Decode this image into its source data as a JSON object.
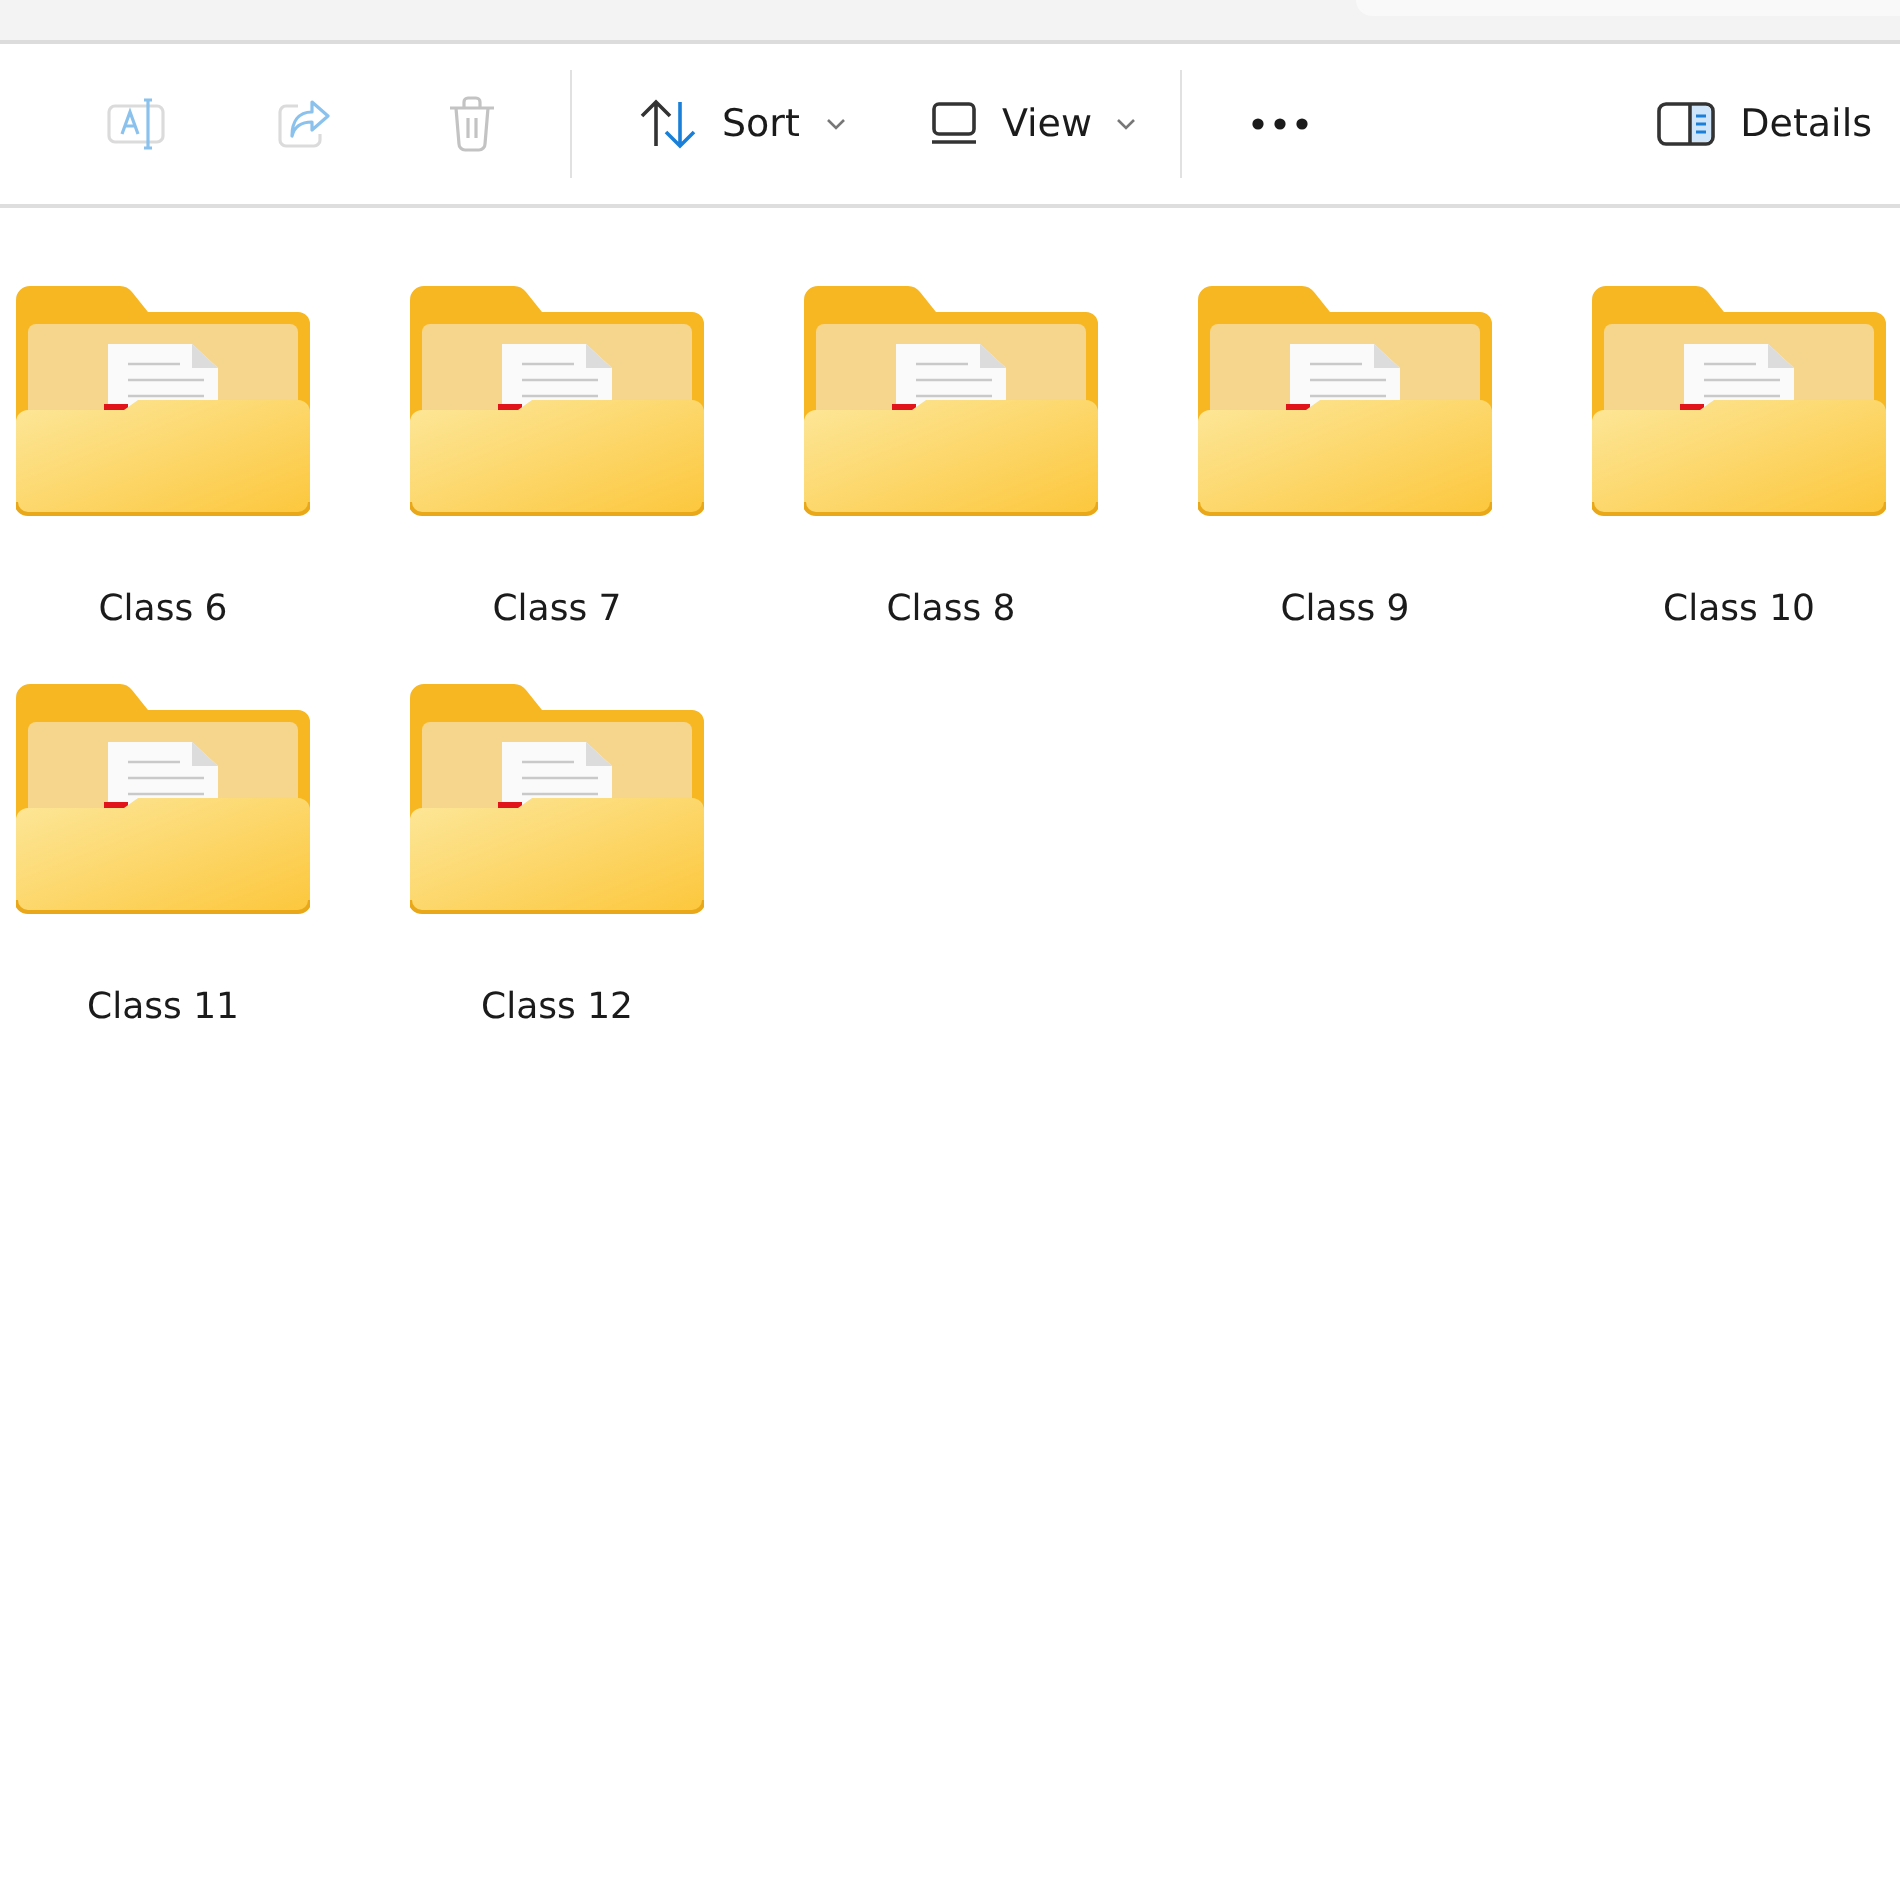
{
  "toolbar": {
    "items": [
      {
        "kind": "rename",
        "disabled": true
      },
      {
        "kind": "share",
        "disabled": true
      },
      {
        "kind": "delete",
        "disabled": true
      },
      {
        "kind": "separator"
      },
      {
        "kind": "sort",
        "label": "Sort",
        "disabled": false
      },
      {
        "kind": "view",
        "label": "View",
        "disabled": false
      },
      {
        "kind": "separator"
      },
      {
        "kind": "more",
        "disabled": false
      },
      {
        "kind": "details",
        "label": "Details",
        "disabled": false
      }
    ]
  },
  "folders": [
    {
      "name": "Class 6"
    },
    {
      "name": "Class 7"
    },
    {
      "name": "Class 8"
    },
    {
      "name": "Class 9"
    },
    {
      "name": "Class 10"
    },
    {
      "name": "Class 11"
    },
    {
      "name": "Class 12"
    }
  ]
}
